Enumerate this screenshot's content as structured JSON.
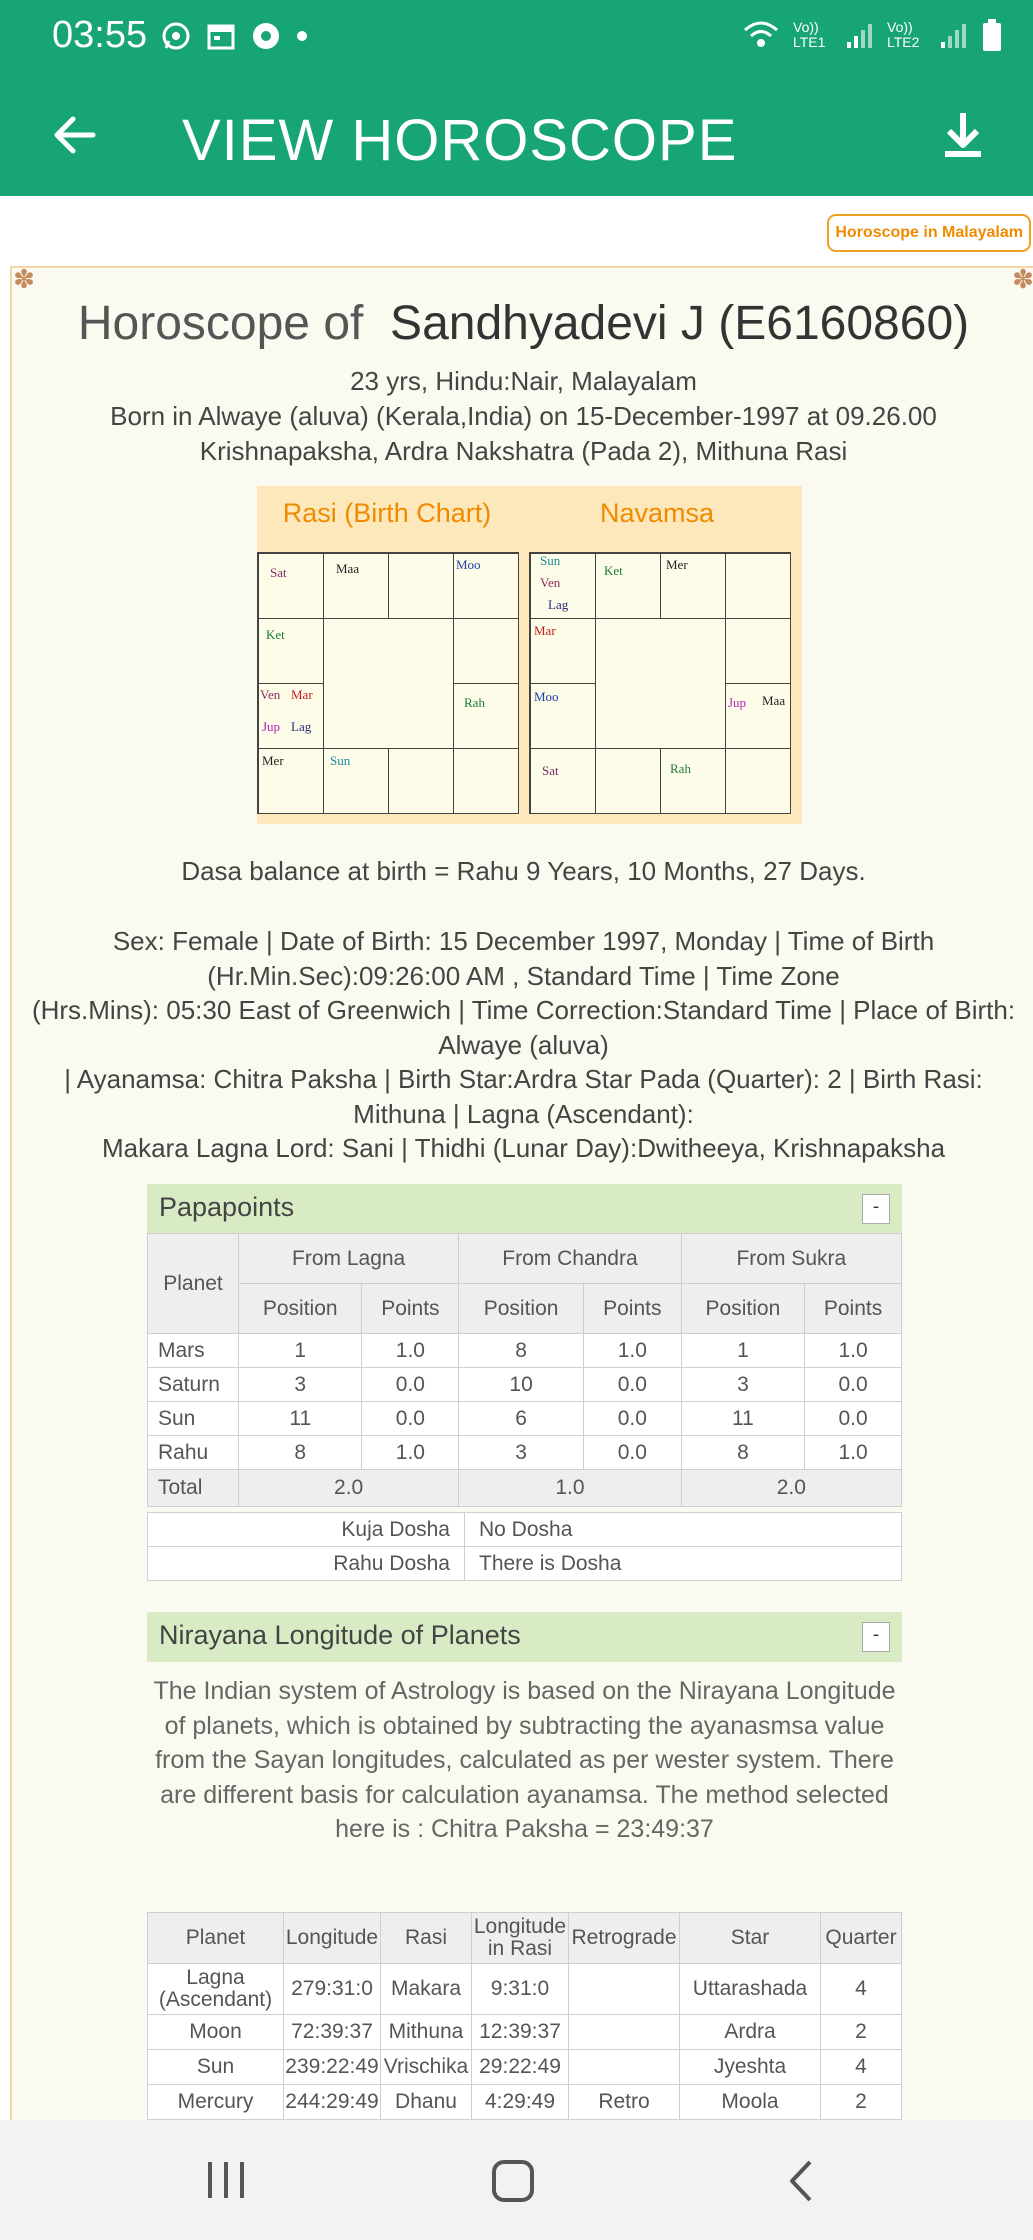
{
  "status": {
    "time": "03:55",
    "lte1": "Vo)) LTE1",
    "lte2": "Vo)) LTE2"
  },
  "appbar": {
    "title": "VIEW HOROSCOPE"
  },
  "malayalam_button": "Horoscope in Malayalam",
  "header": {
    "title_prefix": "Horoscope of",
    "title_name": "Sandhyadevi J (E6160860)",
    "line1": "23 yrs, Hindu:Nair, Malayalam",
    "line2": "Born in Alwaye (aluva) (Kerala,India) on 15-December-1997 at 09.26.00",
    "line3": "Krishnapaksha, Ardra Nakshatra (Pada 2), Mithuna Rasi"
  },
  "charts": {
    "rasi_title": "Rasi (Birth Chart)",
    "navamsa_title": "Navamsa",
    "rasi": {
      "sat": "Sat",
      "maa": "Maa",
      "moo": "Moo",
      "ket": "Ket",
      "ven": "Ven",
      "mar": "Mar",
      "jup": "Jup",
      "lag": "Lag",
      "rah": "Rah",
      "mer": "Mer",
      "sun": "Sun"
    },
    "navamsa": {
      "sun": "Sun",
      "ven": "Ven",
      "lag": "Lag",
      "ket": "Ket",
      "mer": "Mer",
      "mar": "Mar",
      "moo": "Moo",
      "jup": "Jup",
      "maa": "Maa",
      "sat": "Sat",
      "rah": "Rah"
    }
  },
  "dasa": "Dasa balance at birth = Rahu 9 Years, 10 Months, 27 Days.",
  "details": [
    "Sex: Female | Date of Birth: 15 December 1997, Monday | Time of Birth",
    "(Hr.Min.Sec):09:26:00 AM , Standard Time | Time Zone",
    "(Hrs.Mins): 05:30 East of Greenwich | Time Correction:Standard Time | Place of Birth:",
    "Alwaye (aluva)",
    "| Ayanamsa: Chitra Paksha | Birth Star:Ardra Star Pada (Quarter): 2 | Birth Rasi:",
    "Mithuna | Lagna (Ascendant):",
    "Makara Lagna Lord: Sani | Thidhi (Lunar Day):Dwitheeya, Krishnapaksha"
  ],
  "papapoints": {
    "title": "Papapoints",
    "collapse": "-",
    "planet_header": "Planet",
    "groups": [
      "From Lagna",
      "From Chandra",
      "From Sukra"
    ],
    "sub": [
      "Position",
      "Points"
    ],
    "rows": [
      [
        "Mars",
        "1",
        "1.0",
        "8",
        "1.0",
        "1",
        "1.0"
      ],
      [
        "Saturn",
        "3",
        "0.0",
        "10",
        "0.0",
        "3",
        "0.0"
      ],
      [
        "Sun",
        "11",
        "0.0",
        "6",
        "0.0",
        "11",
        "0.0"
      ],
      [
        "Rahu",
        "8",
        "1.0",
        "3",
        "0.0",
        "8",
        "1.0"
      ]
    ],
    "total_label": "Total",
    "totals": [
      "2.0",
      "1.0",
      "2.0"
    ],
    "kuja_label": "Kuja Dosha",
    "kuja_value": "No Dosha",
    "rahu_label": "Rahu Dosha",
    "rahu_value": "There is Dosha"
  },
  "nirayana": {
    "title": "Nirayana Longitude of Planets",
    "collapse": "-",
    "description": "The Indian system of Astrology is based on the Nirayana Longitude of planets, which is obtained by subtracting the ayanasmsa value from the Sayan longitudes, calculated as per wester system. There are different basis for calculation ayanamsa. The method selected here is : Chitra Paksha = 23:49:37",
    "headers": [
      "Planet",
      "Longitude",
      "Rasi",
      "Longitude in Rasi",
      "Retrograde",
      "Star",
      "Quarter"
    ],
    "rows": [
      [
        "Lagna (Ascendant)",
        "279:31:0",
        "Makara",
        "9:31:0",
        "",
        "Uttarashada",
        "4"
      ],
      [
        "Moon",
        "72:39:37",
        "Mithuna",
        "12:39:37",
        "",
        "Ardra",
        "2"
      ],
      [
        "Sun",
        "239:22:49",
        "Vrischika",
        "29:22:49",
        "",
        "Jyeshta",
        "4"
      ],
      [
        "Mercury",
        "244:29:49",
        "Dhanu",
        "4:29:49",
        "Retro",
        "Moola",
        "2"
      ]
    ]
  }
}
